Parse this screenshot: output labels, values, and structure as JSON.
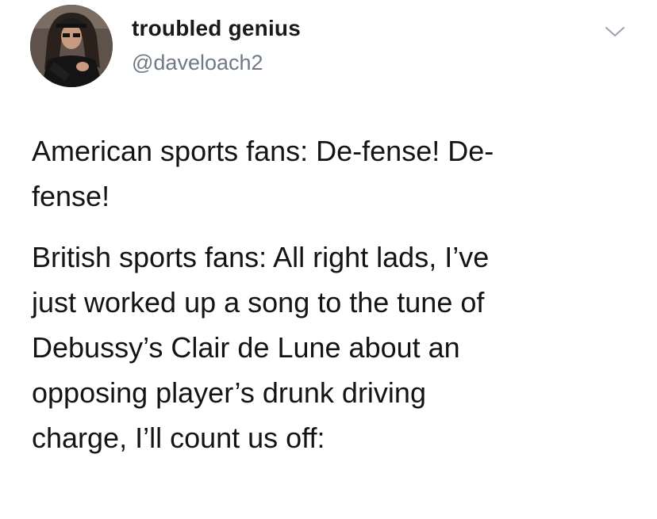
{
  "tweet": {
    "author": {
      "display_name": "troubled genius",
      "handle": "@daveloach2",
      "avatar_icon": "profile-photo"
    },
    "menu_icon": "chevron-down-icon",
    "body": {
      "paragraphs": [
        {
          "lines": [
            "American sports fans: De-fense! De-",
            "fense!"
          ]
        },
        {
          "lines": [
            "British sports fans: All right lads, I’ve",
            "just worked up a song to the tune of",
            "Debussy’s Clair de Lune about an",
            "opposing player’s drunk driving",
            "charge, I’ll count us off:"
          ]
        }
      ]
    }
  },
  "colors": {
    "text": "#141414",
    "handle": "#6f7a84",
    "background": "#ffffff"
  }
}
